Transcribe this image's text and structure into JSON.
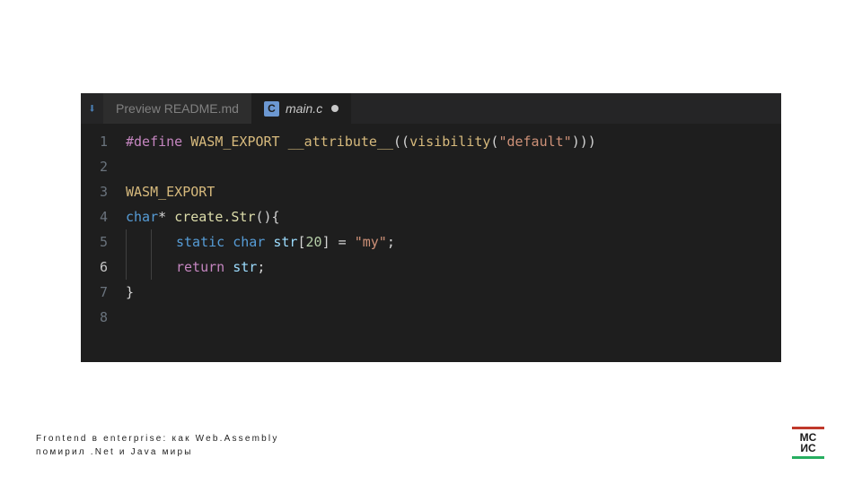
{
  "tabs": {
    "inactive": {
      "label": "Preview README.md"
    },
    "active": {
      "badge": "C",
      "label": "main.c"
    }
  },
  "gutter": [
    "1",
    "2",
    "3",
    "4",
    "5",
    "6",
    "7",
    "8"
  ],
  "code": {
    "l1": {
      "define": "#define",
      "macro": "WASM_EXPORT",
      "attr": "__attribute__",
      "p1": "((",
      "vis": "visibility",
      "p2": "(",
      "str": "\"default\"",
      "p3": ")))"
    },
    "l3": {
      "macro": "WASM_EXPORT"
    },
    "l4": {
      "type": "char",
      "ptr": "*",
      "func": "create.Str",
      "paren": "(){"
    },
    "l5": {
      "kw": "static",
      "type": "char",
      "var": "str",
      "lb": "[",
      "num": "20",
      "rb": "]",
      "eq": " = ",
      "str": "\"my\"",
      "semi": ";"
    },
    "l6": {
      "ret": "return",
      "var": "str",
      "semi": ";"
    },
    "l7": {
      "brace": "}"
    }
  },
  "footer": {
    "line1": "Frontend в enterprise: как Web.Assembly",
    "line2": "помирил .Net и Java миры"
  },
  "logo": {
    "top": "MC",
    "bot": "ИС"
  }
}
